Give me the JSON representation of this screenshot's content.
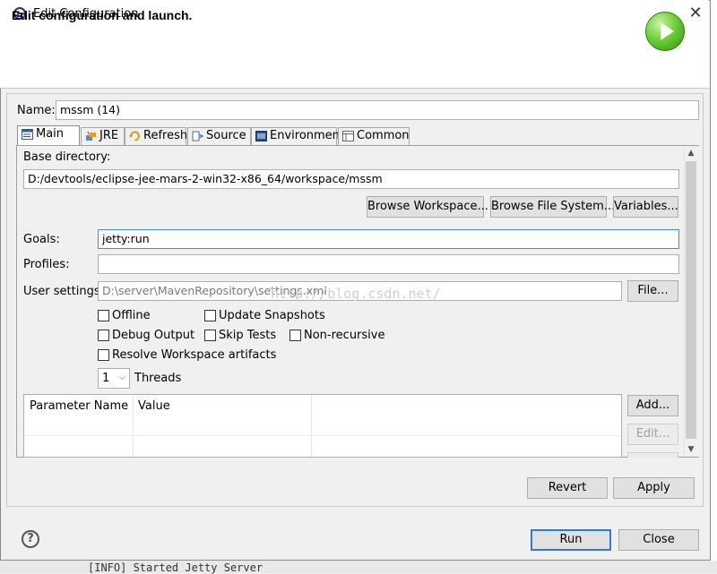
{
  "window": {
    "title": "Edit Configuration",
    "close_glyph": "✕"
  },
  "banner": {
    "title": "Edit configuration and launch."
  },
  "name_field": {
    "label": "Name:",
    "value": "mssm (14)"
  },
  "tabs": [
    {
      "label": "Main",
      "icon": "main-tab-icon",
      "active": true
    },
    {
      "label": "JRE",
      "icon": "jre-icon"
    },
    {
      "label": "Refresh",
      "icon": "refresh-icon"
    },
    {
      "label": "Source",
      "icon": "source-icon"
    },
    {
      "label": "Environment",
      "icon": "environment-icon"
    },
    {
      "label": "Common",
      "icon": "common-icon"
    }
  ],
  "main": {
    "base_directory_label": "Base directory:",
    "base_directory_value": "D:/devtools/eclipse-jee-mars-2-win32-x86_64/workspace/mssm",
    "browse_workspace": "Browse Workspace...",
    "browse_filesystem": "Browse File System...",
    "variables": "Variables...",
    "goals_label": "Goals:",
    "goals_value": "jetty:run",
    "profiles_label": "Profiles:",
    "profiles_value": "",
    "user_settings_label": "User settings:",
    "user_settings_value": "D:\\server\\MavenRepository\\settings.xml",
    "file_button": "File...",
    "checkboxes": {
      "offline": "Offline",
      "update_snapshots": "Update Snapshots",
      "debug_output": "Debug Output",
      "skip_tests": "Skip Tests",
      "non_recursive": "Non-recursive",
      "resolve_workspace": "Resolve Workspace artifacts"
    },
    "threads_value": "1",
    "threads_label": "Threads",
    "params_table": {
      "columns": [
        "Parameter Name",
        "Value"
      ]
    },
    "add_button": "Add...",
    "edit_button": "Edit..."
  },
  "footer": {
    "revert": "Revert",
    "apply": "Apply",
    "run": "Run",
    "close": "Close",
    "help_glyph": "?"
  },
  "background": {
    "console_text": "[INFO] Started Jetty Server"
  },
  "watermark": "http://blog.csdn.net/",
  "colors": {
    "focus_border": "#3c8fe0",
    "run_logo": "#6fcf3a"
  }
}
